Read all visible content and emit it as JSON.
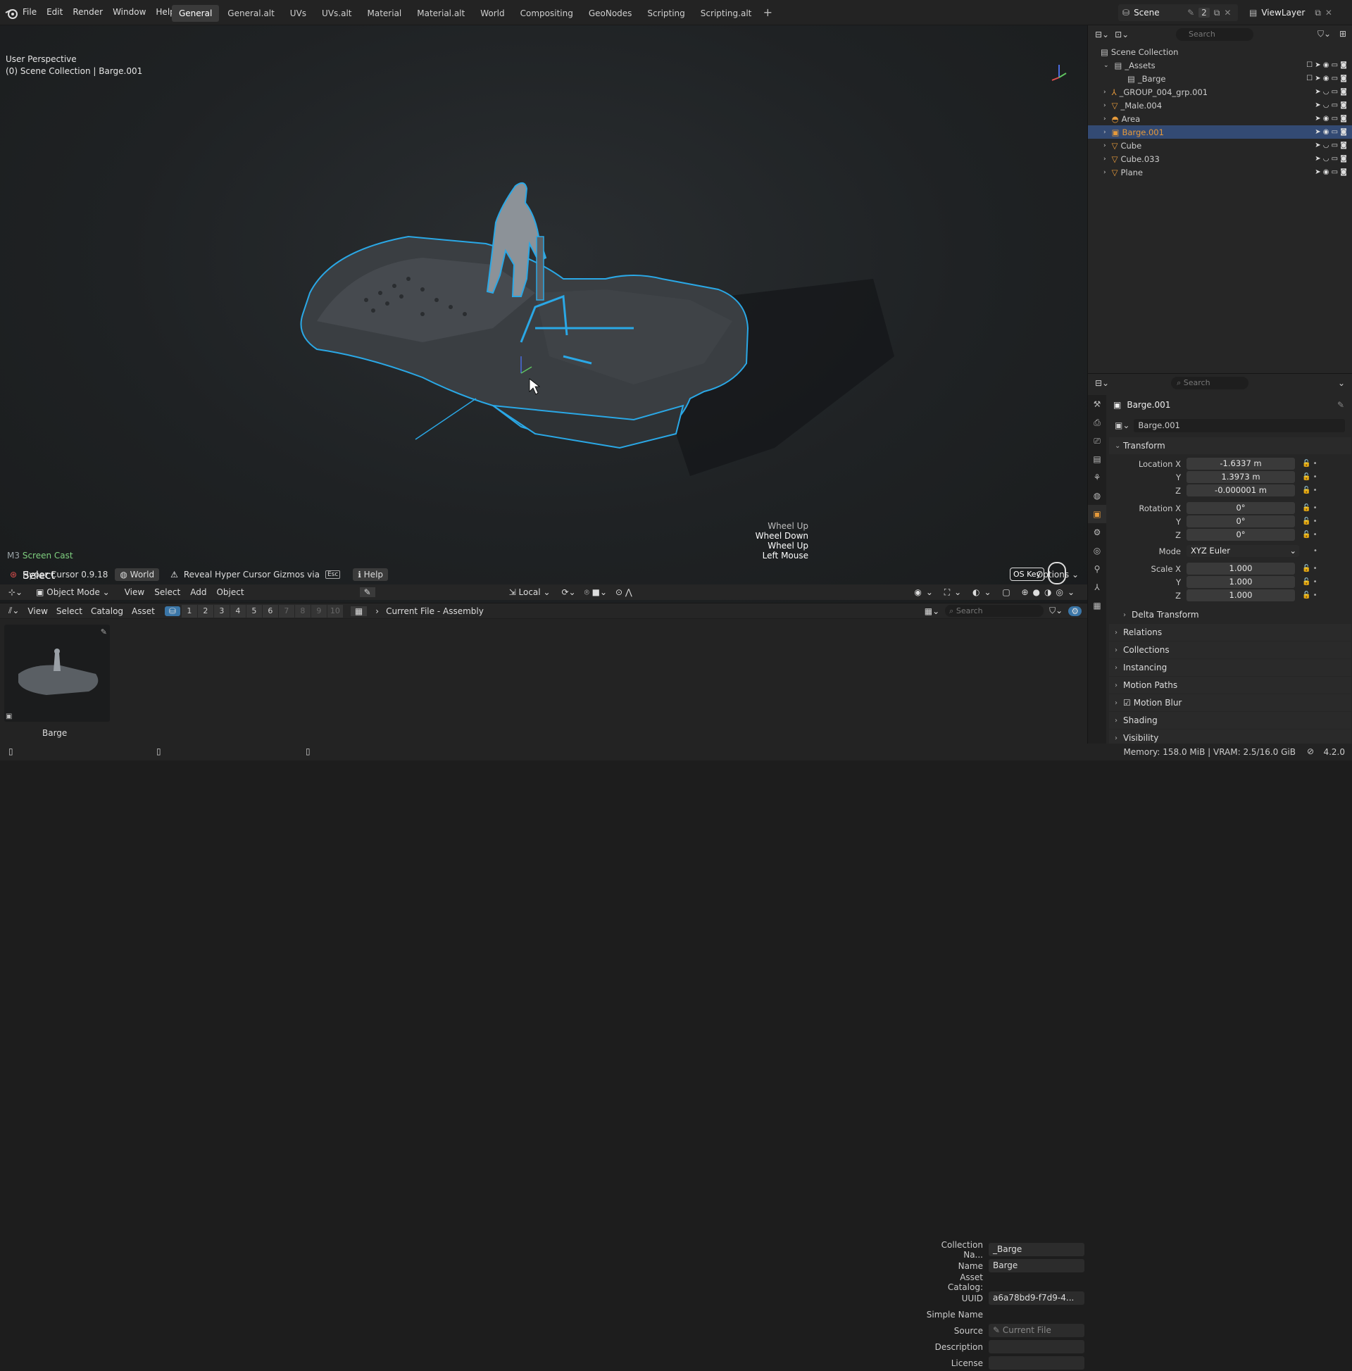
{
  "menu": [
    "File",
    "Edit",
    "Render",
    "Window",
    "Help"
  ],
  "workspaces": [
    "General",
    "General.alt",
    "UVs",
    "UVs.alt",
    "Material",
    "Material.alt",
    "World",
    "Compositing",
    "GeoNodes",
    "Scripting",
    "Scripting.alt"
  ],
  "scene": {
    "name": "Scene",
    "count": "2"
  },
  "viewlayer": "ViewLayer",
  "viewport": {
    "line1": "User Perspective",
    "line2": "(0) Scene Collection | Barge.001",
    "screencast_m3": "M3",
    "screencast_label": "Screen Cast",
    "select_label": "Select",
    "wheel_log": [
      {
        "text": "Wheel Up",
        "bright": false
      },
      {
        "text": "Wheel Down",
        "bright": true
      },
      {
        "text": "Wheel Up",
        "bright": true
      },
      {
        "text": "Left Mouse",
        "bright": true
      }
    ],
    "os_key": "OS Key"
  },
  "hypercursor": {
    "title": "Hyper Cursor 0.9.18",
    "world": "World",
    "reveal": "Reveal Hyper Cursor Gizmos via",
    "esc": "Esc",
    "help": "Help",
    "options": "Options"
  },
  "header3d": {
    "mode": "Object Mode",
    "items": [
      "View",
      "Select",
      "Add",
      "Object"
    ],
    "transform_orientation": "Local"
  },
  "assetbrowser": {
    "items": [
      "View",
      "Select",
      "Catalog",
      "Asset"
    ],
    "numbers": [
      "1",
      "2",
      "3",
      "4",
      "5",
      "6",
      "7",
      "8",
      "9",
      "10"
    ],
    "breadcrumb": "Current File - Assembly",
    "search_placeholder": "Search",
    "thumb_name": "Barge",
    "props": [
      {
        "k": "Collection Na...",
        "v": "_Barge"
      },
      {
        "k": "Name",
        "v": "Barge"
      },
      {
        "k": "Asset Catalog:",
        "v": ""
      },
      {
        "k": "UUID",
        "v": "a6a78bd9-f7d9-4..."
      },
      {
        "k": "Simple Name",
        "v": ""
      },
      {
        "k": "Source",
        "v": "Current File"
      },
      {
        "k": "Description",
        "v": ""
      },
      {
        "k": "License",
        "v": ""
      }
    ]
  },
  "outliner": {
    "search_placeholder": "Search",
    "root": "Scene Collection",
    "rows": [
      {
        "name": "_Assets",
        "indent": 1,
        "selected": false,
        "type": "collection"
      },
      {
        "name": "_Barge",
        "indent": 2,
        "selected": false,
        "type": "collection"
      },
      {
        "name": "_GROUP_004_grp.001",
        "indent": 1,
        "selected": false,
        "type": "armature"
      },
      {
        "name": "_Male.004",
        "indent": 1,
        "selected": false,
        "type": "mesh"
      },
      {
        "name": "Area",
        "indent": 1,
        "selected": false,
        "type": "light"
      },
      {
        "name": "Barge.001",
        "indent": 1,
        "selected": true,
        "type": "empty"
      },
      {
        "name": "Cube",
        "indent": 1,
        "selected": false,
        "type": "mesh"
      },
      {
        "name": "Cube.033",
        "indent": 1,
        "selected": false,
        "type": "mesh"
      },
      {
        "name": "Plane",
        "indent": 1,
        "selected": false,
        "type": "mesh"
      }
    ]
  },
  "properties": {
    "search_placeholder": "Search",
    "object_name": "Barge.001",
    "data_name": "Barge.001",
    "transform_label": "Transform",
    "location": {
      "x": "-1.6337 m",
      "y": "1.3973 m",
      "z": "-0.000001 m"
    },
    "rotation": {
      "x": "0°",
      "y": "0°",
      "z": "0°"
    },
    "mode_label": "Mode",
    "mode_value": "XYZ Euler",
    "scale": {
      "x": "1.000",
      "y": "1.000",
      "z": "1.000"
    },
    "labels": {
      "location_x": "Location X",
      "rotation_x": "Rotation X",
      "scale_x": "Scale X",
      "y": "Y",
      "z": "Z"
    },
    "delta_transform": "Delta Transform",
    "panels": [
      "Relations",
      "Collections",
      "Instancing",
      "Motion Paths",
      "Motion Blur",
      "Shading",
      "Visibility"
    ]
  },
  "status": {
    "memory": "Memory: 158.0 MiB | VRAM: 2.5/16.0 GiB",
    "version": "4.2.0"
  },
  "colors": {
    "accent": "#e69a3b",
    "selection": "#334a73",
    "outline": "#2aa8e6"
  }
}
